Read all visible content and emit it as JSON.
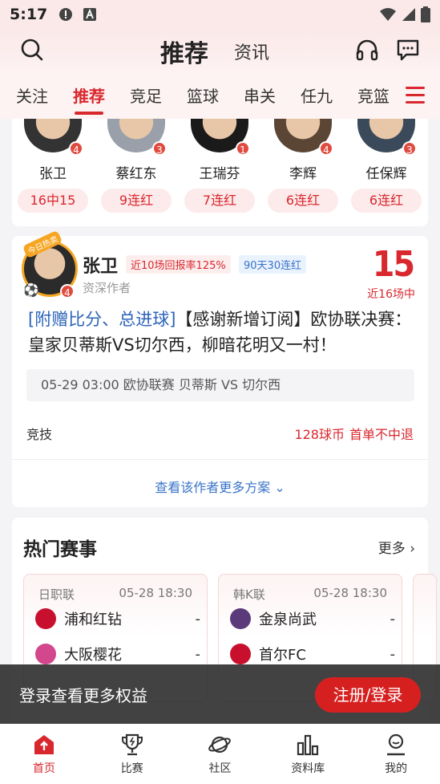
{
  "status_bar": {
    "time": "5:17"
  },
  "topbar": {
    "title": "推荐",
    "subtitle": "资讯"
  },
  "tabs": [
    "关注",
    "推荐",
    "竞足",
    "篮球",
    "串关",
    "任九",
    "竞篮"
  ],
  "active_tab_index": 1,
  "experts": [
    {
      "name": "张卫",
      "badge": "4",
      "stat": "16中15"
    },
    {
      "name": "蔡红东",
      "badge": "3",
      "stat": "9连红"
    },
    {
      "name": "王瑞芬",
      "badge": "1",
      "stat": "7连红"
    },
    {
      "name": "李辉",
      "badge": "4",
      "stat": "6连红"
    },
    {
      "name": "任保辉",
      "badge": "3",
      "stat": "6连红"
    }
  ],
  "post": {
    "ribbon": "今日热卖",
    "badge": "4",
    "author": "张卫",
    "tag_return": "近10场回报率125%",
    "tag_streak": "90天30连红",
    "role": "资深作者",
    "hit_number": "15",
    "hit_label": "近16场中",
    "headline_highlight": "[附赠比分、总进球]",
    "headline_rest": "【感谢新增订阅】欧协联决赛：皇家贝蒂斯VS切尔西，柳暗花明又一村！",
    "match_info": "05-29 03:00  欧协联赛 贝蒂斯 VS 切尔西",
    "sport": "竞技",
    "price": "128球币",
    "price_note": "首单不中退",
    "more_link": "查看该作者更多方案"
  },
  "hot": {
    "title": "热门赛事",
    "more": "更多",
    "matches": [
      {
        "league": "日职联",
        "time": "05-28 18:30",
        "home": {
          "name": "浦和红钻",
          "score": "-",
          "color": "#c8102e"
        },
        "away": {
          "name": "大阪樱花",
          "score": "-",
          "color": "#d3478c"
        }
      },
      {
        "league": "韩K联",
        "time": "05-28 18:30",
        "home": {
          "name": "金泉尚武",
          "score": "-",
          "color": "#5a3a7a"
        },
        "away": {
          "name": "首尔FC",
          "score": "-",
          "color": "#c8102e"
        }
      }
    ]
  },
  "login_bar": {
    "text": "登录查看更多权益",
    "button": "注册/登录"
  },
  "bottom_nav": [
    {
      "label": "首页",
      "icon": "home-icon"
    },
    {
      "label": "比赛",
      "icon": "trophy-icon"
    },
    {
      "label": "社区",
      "icon": "planet-icon"
    },
    {
      "label": "资料库",
      "icon": "chart-icon"
    },
    {
      "label": "我的",
      "icon": "person-icon"
    }
  ],
  "colors": {
    "accent": "#d9272e",
    "link": "#3a74c8"
  }
}
